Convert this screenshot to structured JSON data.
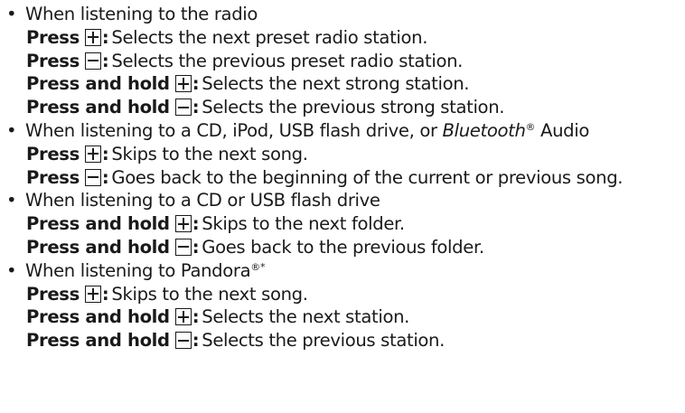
{
  "sections": [
    {
      "heading": "When listening to the radio",
      "items": [
        {
          "action": "Press",
          "button": "+",
          "description": "Selects the next preset radio station."
        },
        {
          "action": "Press",
          "button": "−",
          "description": "Selects the previous preset radio station."
        },
        {
          "action": "Press and hold",
          "button": "+",
          "description": "Selects the next strong station."
        },
        {
          "action": "Press and hold",
          "button": "−",
          "description": "Selects the previous strong station."
        }
      ]
    },
    {
      "heading_parts": {
        "pre": "When listening to a CD, iPod, USB flash drive, or ",
        "italic": "Bluetooth",
        "reg": "®",
        "post": " Audio"
      },
      "items": [
        {
          "action": "Press",
          "button": "+",
          "description": "Skips to the next song."
        },
        {
          "action": "Press",
          "button": "−",
          "description": "Goes back to the beginning of the current or previous song."
        }
      ]
    },
    {
      "heading": "When listening to a CD or USB flash drive",
      "items": [
        {
          "action": "Press and hold",
          "button": "+",
          "description": "Skips to the next folder."
        },
        {
          "action": "Press and hold",
          "button": "−",
          "description": "Goes back to the previous folder."
        }
      ]
    },
    {
      "heading_parts": {
        "pre": "When listening to Pandora",
        "reg": "®",
        "star": "*"
      },
      "items": [
        {
          "action": "Press",
          "button": "+",
          "description": "Skips to the next song."
        },
        {
          "action": "Press and hold",
          "button": "+",
          "description": "Selects the next station."
        },
        {
          "action": "Press and hold",
          "button": "−",
          "description": "Selects the previous station."
        }
      ]
    }
  ],
  "bullet_symbol": "•",
  "colon": ":",
  "icons": {
    "plus": "plus-button-icon",
    "minus": "minus-button-icon"
  }
}
